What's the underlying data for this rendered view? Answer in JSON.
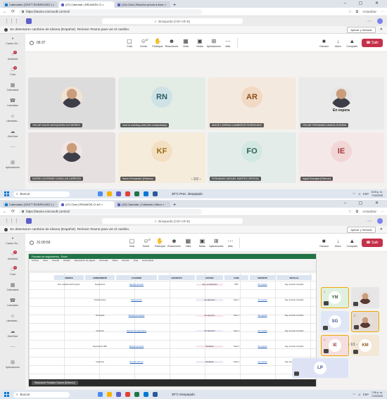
{
  "colors": {
    "accent": "#5b5fc7",
    "leave": "#c4314b",
    "raised_hand_border": "#f0a800"
  },
  "shot1": {
    "tabs": [
      {
        "label": "Calendario (OSITT RODRIGUEZ ) ×",
        "fav": "#0078d4"
      },
      {
        "label": "(27) Calendar | REUNIÓN CI ×",
        "fav": "#5b5fc7"
      },
      {
        "label": "(24) Chat | Reunión previa a Asor ×",
        "fav": "#5b5fc7"
      }
    ],
    "url": "https://teams.microsoft.com/v2/",
    "update_label": "Actualizar",
    "search_placeholder": "Búsqueda (Ctrl+Alt+E)",
    "banner_text": "Se detectaron cambios de idioma (Español). Reinicie Teams para ver el cambio.",
    "banner_button": "Aplicar y reiniciar",
    "timer": "06:37",
    "rail": [
      {
        "glyph": "•",
        "label": "Camer-Vis..."
      },
      {
        "glyph": "○",
        "label": "Actividad",
        "badge": "1"
      },
      {
        "glyph": "□",
        "label": "Chat",
        "badge": "1"
      },
      {
        "glyph": "▦",
        "label": "Calendario"
      },
      {
        "glyph": "☎",
        "label": "Llamadas"
      },
      {
        "glyph": "☺",
        "label": "Llamadas..."
      },
      {
        "glyph": "☁",
        "label": "OneDrive"
      },
      {
        "glyph": "⋯",
        "label": ""
      },
      {
        "glyph": "⊞",
        "label": "Aplicaciones"
      }
    ],
    "toolbar": [
      {
        "glyph": "▢",
        "label": "Chat"
      },
      {
        "glyph": "☺",
        "label": "Gente"
      },
      {
        "glyph": "✋",
        "label": "Participar"
      },
      {
        "glyph": "☻",
        "label": "Reacciones"
      },
      {
        "glyph": "▦",
        "label": "Vista"
      },
      {
        "glyph": "▣",
        "label": "Notas"
      },
      {
        "glyph": "⊞",
        "label": "Aplicaciones"
      },
      {
        "glyph": "⋯",
        "label": "Más"
      }
    ],
    "people_count": "67",
    "controls": [
      {
        "glyph": "■",
        "label": "Cámara"
      },
      {
        "glyph": "↓",
        "label": "Micro"
      },
      {
        "glyph": "▲",
        "label": "Compartir"
      }
    ],
    "leave_label": "Salir",
    "tiles": [
      {
        "name": "OSCAR DAVID MOSQUERA GUTIERREZ",
        "initials": "",
        "photo": true,
        "bg": "#dcdcdc",
        "ring": "#f1e3d3"
      },
      {
        "name": "med.ia meeting notes (No comprobado)",
        "initials": "RN",
        "bg": "#e4ece6",
        "ring": "#cfe3e6",
        "ink": "#2f5f6a"
      },
      {
        "name": "ANGIE LORENA CAMBEROS RODRIGUEZ",
        "initials": "AR",
        "bg": "#f3e9df",
        "ring": "#f1d9c4",
        "ink": "#8a4f19"
      },
      {
        "name": "OSCAR FERNANDO AMAYA GUFARA",
        "initials": "",
        "photo": true,
        "bg": "#eaeaea",
        "ring": "#e6e6e6",
        "status": "En espera"
      },
      {
        "name": "INGRID CATERINE CASALLAS LARROTA",
        "initials": "",
        "photo": true,
        "bg": "#e6e0e0",
        "ring": "#f2e5e5"
      },
      {
        "name": "Karen Fernandez (Externo)",
        "initials": "KF",
        "bg": "#f5ecdc",
        "ring": "#f3e0c2",
        "ink": "#9a6a12"
      },
      {
        "name": "FERNANDO MIGUEL MARTES ORTEGA",
        "initials": "FO",
        "bg": "#e3ece9",
        "ring": "#d3e8e3",
        "ink": "#2c6154"
      },
      {
        "name": "Ingral Energica (Externo)",
        "initials": "IE",
        "bg": "#f5e8e8",
        "ring": "#f2d6d6",
        "ink": "#a13a3a"
      }
    ],
    "pager": "‹  2/2  ›",
    "taskbar": {
      "search": "Buscar",
      "weather": "30°C  Prec. despejado",
      "lang": "ESP",
      "time": "6:03 p. m.",
      "date": "7/10/2025"
    }
  },
  "shot2": {
    "tabs": [
      {
        "label": "Calendario (OSITT RODRIGUEZ ) ×",
        "fav": "#0078d4"
      },
      {
        "label": "(27) Chat | REUNIÓN CI AX ×",
        "fav": "#5b5fc7"
      },
      {
        "label": "(20) Calendar | Calendar | Micro ×",
        "fav": "#5b5fc7"
      }
    ],
    "url": "https://teams.microsoft.com/v2/",
    "update_label": "Actualizar",
    "search_placeholder": "Búsqueda (Ctrl+Alt+E)",
    "banner_text": "Se detectaron cambios de idioma (Español). Reinicie Teams para ver el cambio.",
    "banner_button": "Aplicar y reiniciar",
    "timer": "31:00:59",
    "leave_label": "Salir",
    "excel_title": "Formato de seguimiento - Excel",
    "excel_tabs": [
      "Archivo",
      "Inicio",
      "Insertar",
      "Dibujar",
      "Disposición de página",
      "Fórmulas",
      "Datos",
      "Revisar",
      "Vista",
      "Automatizar"
    ],
    "columns": [
      "FRENTE",
      "COMPONENTE",
      "ACUERDO",
      "CONTRATO",
      "ESTADO",
      "FASE",
      "SOPORTE",
      "DETALLE"
    ],
    "rows": [
      [
        "Rev. Auditoría del Proyecto",
        "Seguimiento",
        "Reunión de inicio",
        "",
        "Seg. cumplimiento",
        "PDF",
        "Ver soporte",
        "Seg. acuerdo cumplido"
      ],
      [
        "",
        "Infraestructura",
        "Mesa técnica",
        "",
        "En ejecución",
        "Fase 1",
        "Ver soporte",
        "Seg. acuerdo cumplido"
      ],
      [
        "",
        "Tecnología",
        "Revisión de avance",
        "",
        "En ejecución",
        "Fase 1",
        "Ver soporte",
        "Seg. acuerdo cumplido"
      ],
      [
        "",
        "Cobertura",
        "Reunión de seguimiento",
        "",
        "En ejecución",
        "Fase 2",
        "Ver soporte",
        "Seg. acuerdo cumplido"
      ],
      [
        "",
        "Seguimiento ABC",
        "Reunión de cierre",
        "",
        "Pendiente",
        "Fase 2",
        "Ver soporte",
        "Seg. acuerdo cumplido"
      ],
      [
        "",
        "Ingeniería",
        "Revisión técnica",
        "",
        "Pendiente",
        "Fase 3",
        "Ver soporte",
        "Seg. acuerdo cumplido"
      ]
    ],
    "presenter": "Stephanie Rosales Garcia (Externo)",
    "side_tiles": [
      {
        "initials": "YM",
        "bg": "#dff0df",
        "ink": "#2f6b2f",
        "hand": "1",
        "raised": true
      },
      {
        "initials": "",
        "photo": true,
        "bg": "#e6e6e6",
        "raised": false
      },
      {
        "initials": "SG",
        "bg": "#dfe6f5",
        "ink": "#3a5590",
        "raised": false
      },
      {
        "initials": "",
        "photo": true,
        "bg": "#e6dcd6",
        "hand": "2",
        "raised": true
      },
      {
        "initials": "IE",
        "bg": "#f5dede",
        "ink": "#a13a3a",
        "hand": "1",
        "raised": true
      },
      {
        "initials": "KM",
        "bg": "#f3e7d6",
        "ink": "#8a5a17",
        "raised": false
      },
      {
        "initials": "LP",
        "bg": "#dde3f5",
        "ink": "#3b4d94",
        "raised": false
      }
    ],
    "pager": "‹  1/1  ›",
    "taskbar": {
      "search": "Buscar",
      "weather": "30°C  Despejado",
      "lang": "ESP",
      "time": "7:00 p. m.",
      "date": "7/10/2025"
    }
  }
}
